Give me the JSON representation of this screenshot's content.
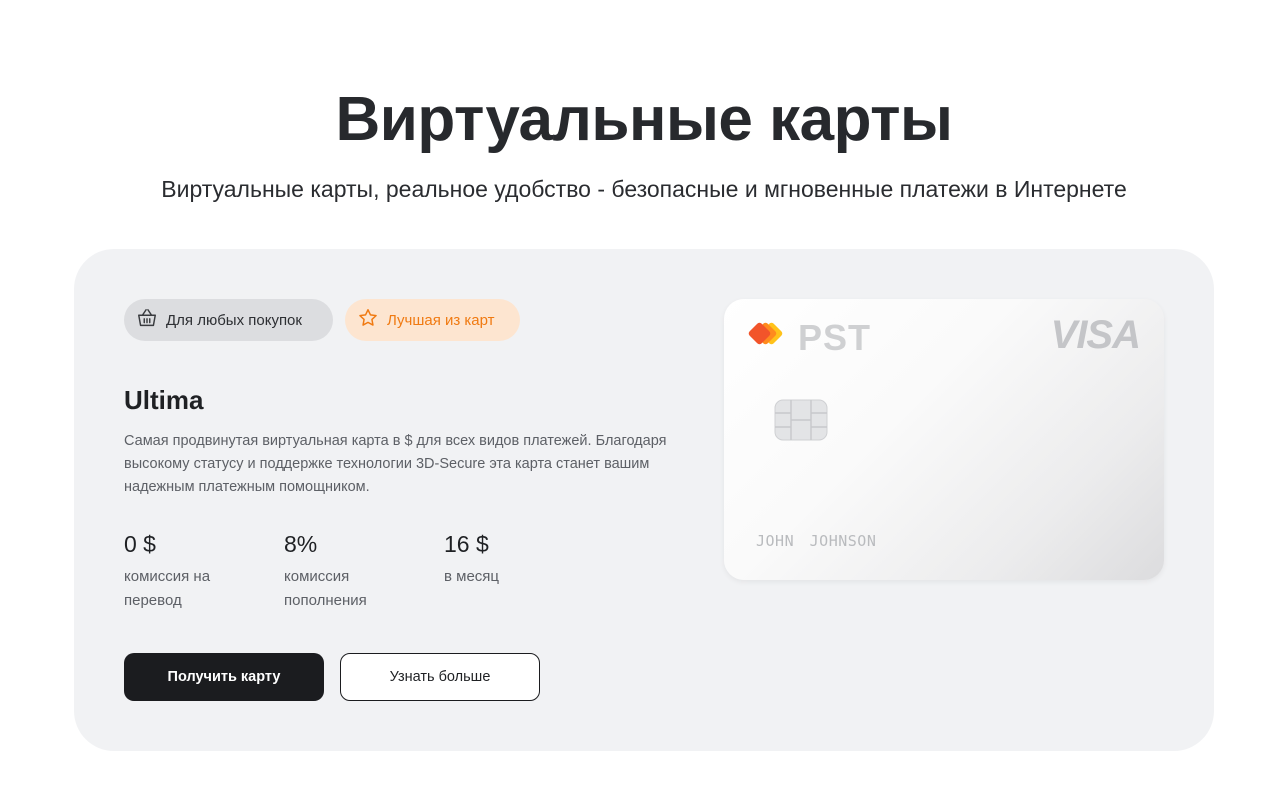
{
  "header": {
    "title": "Виртуальные карты",
    "subtitle": "Виртуальные карты, реальное удобство - безопасные и мгновенные платежи в Интернете"
  },
  "card_offer": {
    "tags": [
      {
        "label": "Для любых покупок",
        "icon": "basket-icon"
      },
      {
        "label": "Лучшая из карт",
        "icon": "star-icon"
      }
    ],
    "name": "Ultima",
    "description": "Самая продвинутая виртуальная карта в $ для всех видов платежей. Благодаря высокому статусу и поддержке технологии 3D-Secure эта карта станет вашим надежным платежным помощником.",
    "stats": [
      {
        "value": "0 $",
        "label": "комиссия на перевод"
      },
      {
        "value": "8%",
        "label": "комиссия пополнения"
      },
      {
        "value": "16 $",
        "label": "в месяц"
      }
    ],
    "buttons": {
      "primary": "Получить карту",
      "secondary": "Узнать больше"
    }
  },
  "card_image": {
    "brand": "PST",
    "network": "VISA",
    "holder": "JOHN JOHNSON"
  },
  "colors": {
    "panel_bg": "#f1f2f4",
    "primary_button": "#1b1c1f",
    "accent_orange": "#f07a12",
    "accent_orange_bg": "#fde5d0",
    "tag_gray_bg": "#dcdde0"
  }
}
